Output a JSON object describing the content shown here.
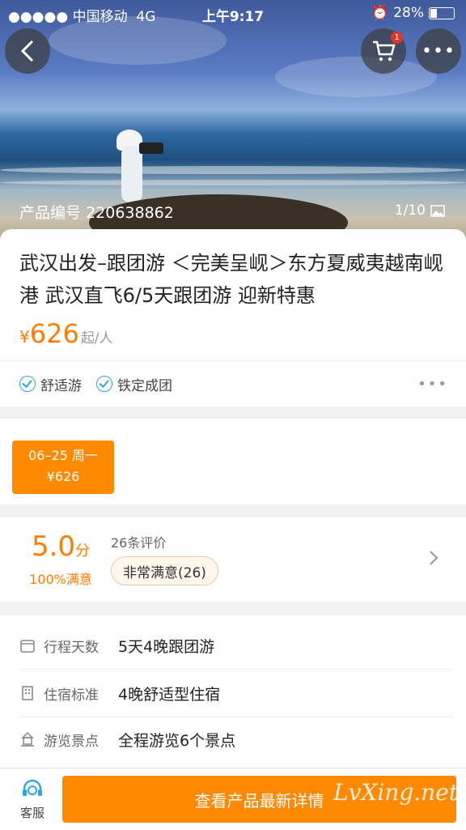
{
  "status": {
    "carrier": "●●●●● 中国移动",
    "network": "4G",
    "time": "上午9:17",
    "battery": "28%"
  },
  "hero": {
    "product_label": "产品编号",
    "product_no": "220638862",
    "page": "1/10",
    "cart_badge": "1"
  },
  "product": {
    "title": "武汉出发–跟团游 ＜完美呈岘＞东方夏威夷越南岘港 武汉直飞6/5天跟团游 迎新特惠",
    "currency": "¥",
    "price": "626",
    "unit": "起/人",
    "tags": [
      "舒适游",
      "铁定成团"
    ]
  },
  "date": {
    "date_label": "06–25 周一",
    "price_label": "¥626"
  },
  "rating": {
    "score": "5.0",
    "score_unit": "分",
    "satisfaction": "100%满意",
    "count": "26条评价",
    "pill": "非常满意(26)"
  },
  "details": [
    {
      "label": "行程天数",
      "value": "5天4晚跟团游",
      "icon": "calendar-icon"
    },
    {
      "label": "住宿标准",
      "value": "4晚舒适型住宿",
      "icon": "building-icon"
    },
    {
      "label": "游览景点",
      "value": "全程游览6个景点",
      "icon": "landmark-icon"
    }
  ],
  "bottom": {
    "service": "客服",
    "cta": "查看产品最新详情",
    "watermark": "LvXing.net"
  },
  "colors": {
    "accent": "#ff8a00",
    "check": "#2aa8e0"
  }
}
